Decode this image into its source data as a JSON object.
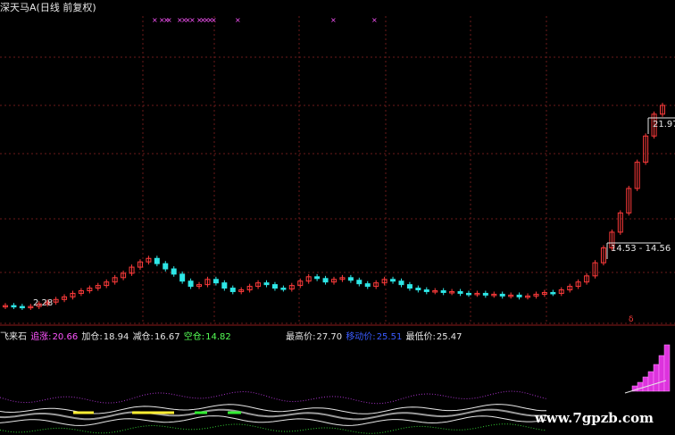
{
  "header": {
    "stock_name": "深天马A",
    "period_label": "(日线 前复权)"
  },
  "main_panel": {
    "price_low_label": "2.28",
    "marker_range_1": "14.53 - 14.56",
    "marker_range_2": "21.97 -",
    "signal_marker": "δ"
  },
  "indicator_panel": {
    "name": "飞来石",
    "fields": [
      {
        "label": "追涨:",
        "value": "20.66",
        "color": "#ff55ff"
      },
      {
        "label": "加仓:",
        "value": "18.94",
        "color": "#e6e6e6"
      },
      {
        "label": "减仓:",
        "value": "16.67",
        "color": "#e6e6e6"
      },
      {
        "label": "空仓:",
        "value": "14.82",
        "color": "#55ff55"
      }
    ],
    "stats": [
      {
        "label": "最高价:",
        "value": "27.70",
        "color": "#e6e6e6"
      },
      {
        "label": "移动价:",
        "value": "25.51",
        "color": "#3a5bff"
      },
      {
        "label": "最低价:",
        "value": "25.47",
        "color": "#e6e6e6"
      }
    ]
  },
  "watermark": "www.7gpzb.com",
  "chart_data": {
    "type": "candlestick",
    "x": [],
    "close_series": [
      2.6,
      2.5,
      2.4,
      2.5,
      2.8,
      3.0,
      3.3,
      3.6,
      4.0,
      4.3,
      4.6,
      4.9,
      5.3,
      5.8,
      6.3,
      7.0,
      7.6,
      8.0,
      7.4,
      6.8,
      6.2,
      5.4,
      4.8,
      5.0,
      5.6,
      5.2,
      4.6,
      4.2,
      4.4,
      4.8,
      5.2,
      5.0,
      4.6,
      4.5,
      4.9,
      5.4,
      5.9,
      5.7,
      5.3,
      5.6,
      5.8,
      5.5,
      5.1,
      4.8,
      5.2,
      5.6,
      5.4,
      5.0,
      4.6,
      4.4,
      4.2,
      4.3,
      4.1,
      4.2,
      4.0,
      3.9,
      4.0,
      3.8,
      3.9,
      3.7,
      3.8,
      3.6,
      3.7,
      3.9,
      4.1,
      4.0,
      4.4,
      4.8,
      5.3,
      6.0,
      7.5,
      9.2,
      11.0,
      13.2,
      16.0,
      19.0,
      22.0,
      24.5,
      25.5
    ],
    "colors": {
      "up": "#ff3b3b",
      "down": "#2ee6e6",
      "grid": "#6b1a1a"
    }
  }
}
